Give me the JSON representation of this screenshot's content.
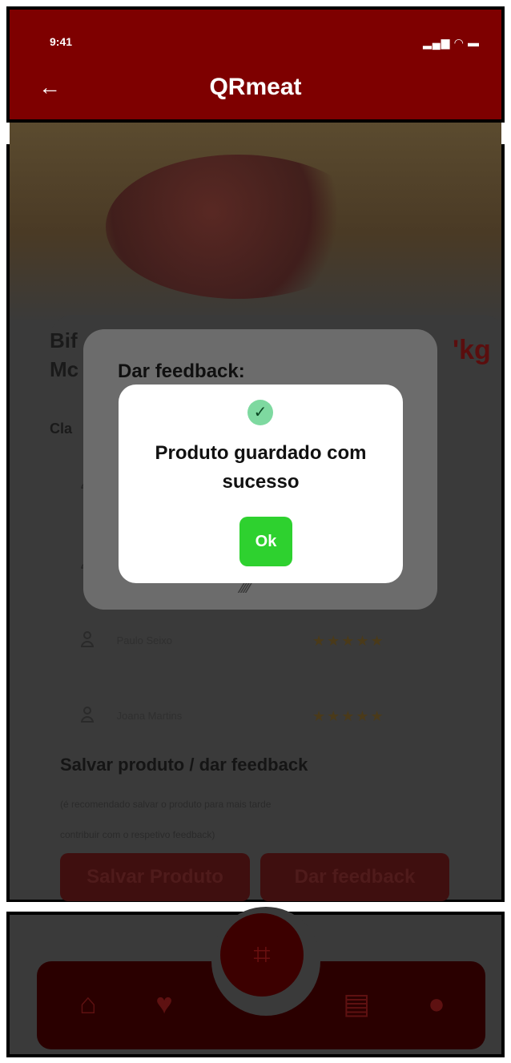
{
  "status_bar": {
    "time": "9:41",
    "indicators": "▂▄▆ ◠ ▬"
  },
  "header": {
    "title": "QRmeat",
    "back_icon": "arrow-left-icon"
  },
  "product": {
    "title_line1": "Bif",
    "title_line2": "Mc",
    "price_fragment": "'kg",
    "classification_label": "Cla"
  },
  "reviews": [
    {
      "name": "",
      "stars": ""
    },
    {
      "name": "",
      "stars": ""
    },
    {
      "name": "Paulo Seixo",
      "stars": "★★★★★"
    },
    {
      "name": "Joana Martins",
      "stars": "★★★★★"
    }
  ],
  "save_section": {
    "title": "Salvar produto / dar feedback",
    "subtitle_line1": "(é recomendado salvar o produto para mais tarde",
    "subtitle_line2": "contribuir com o respetivo feedback)",
    "save_button": "Salvar Produto",
    "feedback_button": "Dar feedback"
  },
  "modal": {
    "heading": "Dar feedback:",
    "spinner": "⁄⁄⁄⁄",
    "message_line1": "Produto guardado com",
    "message_line2": "sucesso",
    "ok_label": "Ok",
    "check_icon": "check-circle-icon"
  },
  "bottom_nav": {
    "home_icon": "home-icon",
    "heart_icon": "heart-icon",
    "scan_icon": "qr-scan-icon",
    "doc_icon": "document-icon",
    "user_icon": "user-icon"
  }
}
